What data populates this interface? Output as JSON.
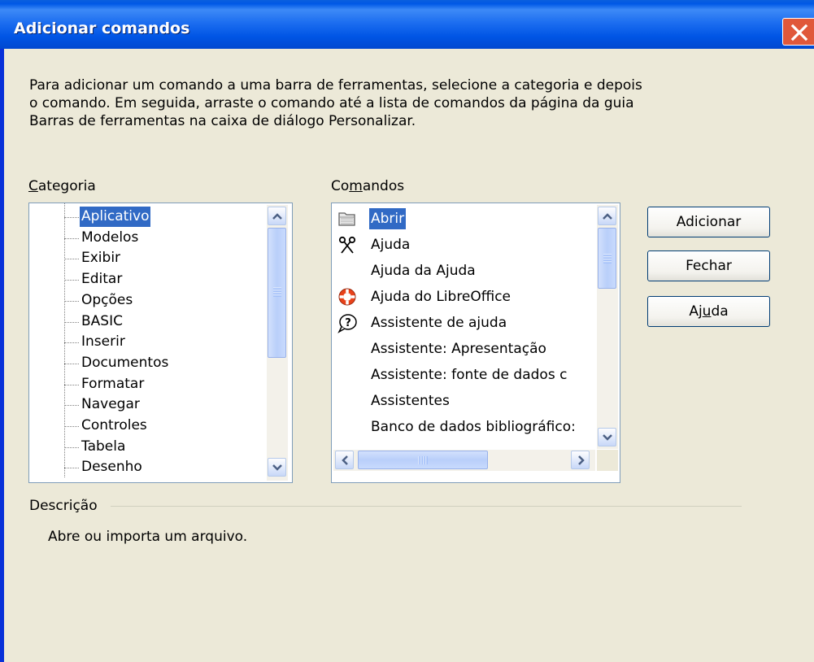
{
  "window": {
    "title": "Adicionar comandos",
    "close_icon": "close-icon"
  },
  "intro": {
    "text": "Para adicionar um comando a uma barra de ferramentas, selecione a categoria e depois o comando. Em seguida, arraste o comando até a lista de comandos da página da guia Barras de ferramentas na caixa de diálogo Personalizar."
  },
  "category": {
    "label": "Categoria",
    "items": [
      "Aplicativo",
      "Modelos",
      "Exibir",
      "Editar",
      "Opções",
      "BASIC",
      "Inserir",
      "Documentos",
      "Formatar",
      "Navegar",
      "Controles",
      "Tabela",
      "Desenho"
    ],
    "selected": "Aplicativo"
  },
  "commands": {
    "label": "Comandos",
    "items": [
      {
        "label": "Abrir",
        "icon": "folder-open-icon"
      },
      {
        "label": "Ajuda",
        "icon": "scissors-icon"
      },
      {
        "label": "Ajuda da Ajuda",
        "icon": ""
      },
      {
        "label": "Ajuda do LibreOffice",
        "icon": "lifebuoy-icon"
      },
      {
        "label": "Assistente de ajuda",
        "icon": "question-balloon-icon"
      },
      {
        "label": "Assistente: Apresentação",
        "icon": ""
      },
      {
        "label": "Assistente: fonte de dados c",
        "icon": ""
      },
      {
        "label": "Assistentes",
        "icon": ""
      },
      {
        "label": "Banco de dados bibliográfico:",
        "icon": ""
      }
    ],
    "selected": "Abrir"
  },
  "buttons": {
    "add": "Adicionar",
    "close": "Fechar",
    "help": "Ajuda"
  },
  "description": {
    "label": "Descrição",
    "text": "Abre ou importa um arquivo."
  },
  "colors": {
    "titlebar": "#0055e5",
    "selection": "#316ac5",
    "dialog_bg": "#ece9d8",
    "close_button": "#e0583a"
  }
}
